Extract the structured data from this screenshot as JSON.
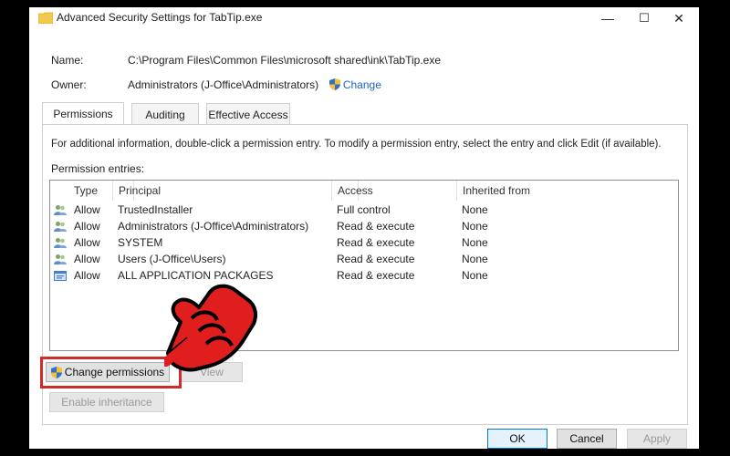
{
  "window": {
    "title": "Advanced Security Settings for TabTip.exe",
    "controls": {
      "minimize": "—",
      "maximize": "☐",
      "close": "✕"
    }
  },
  "details": {
    "name_label": "Name:",
    "name_value": "C:\\Program Files\\Common Files\\microsoft shared\\ink\\TabTip.exe",
    "owner_label": "Owner:",
    "owner_value": "Administrators (J-Office\\Administrators)",
    "change_link": "Change"
  },
  "tabs": [
    {
      "label": "Permissions",
      "active": true
    },
    {
      "label": "Auditing",
      "active": false
    },
    {
      "label": "Effective Access",
      "active": false
    }
  ],
  "permissions": {
    "info_text": "For additional information, double-click a permission entry. To modify a permission entry, select the entry and click Edit (if available).",
    "entries_label": "Permission entries:",
    "columns": [
      "Type",
      "Principal",
      "Access",
      "Inherited from"
    ],
    "rows": [
      {
        "icon": "users-icon",
        "type": "Allow",
        "principal": "TrustedInstaller",
        "access": "Full control",
        "inherited": "None"
      },
      {
        "icon": "users-icon",
        "type": "Allow",
        "principal": "Administrators (J-Office\\Administrators)",
        "access": "Read & execute",
        "inherited": "None"
      },
      {
        "icon": "users-icon",
        "type": "Allow",
        "principal": "SYSTEM",
        "access": "Read & execute",
        "inherited": "None"
      },
      {
        "icon": "users-icon",
        "type": "Allow",
        "principal": "Users (J-Office\\Users)",
        "access": "Read & execute",
        "inherited": "None"
      },
      {
        "icon": "app-packages-icon",
        "type": "Allow",
        "principal": "ALL APPLICATION PACKAGES",
        "access": "Read & execute",
        "inherited": "None"
      }
    ],
    "change_permissions_button": "Change permissions",
    "view_button": "View",
    "enable_inheritance_button": "Enable inheritance"
  },
  "footer": {
    "ok": "OK",
    "cancel": "Cancel",
    "apply": "Apply"
  },
  "colors": {
    "accent_link": "#1b64c8",
    "highlight_box": "#d22a2a",
    "pointer_hand": "#e01e1e"
  }
}
